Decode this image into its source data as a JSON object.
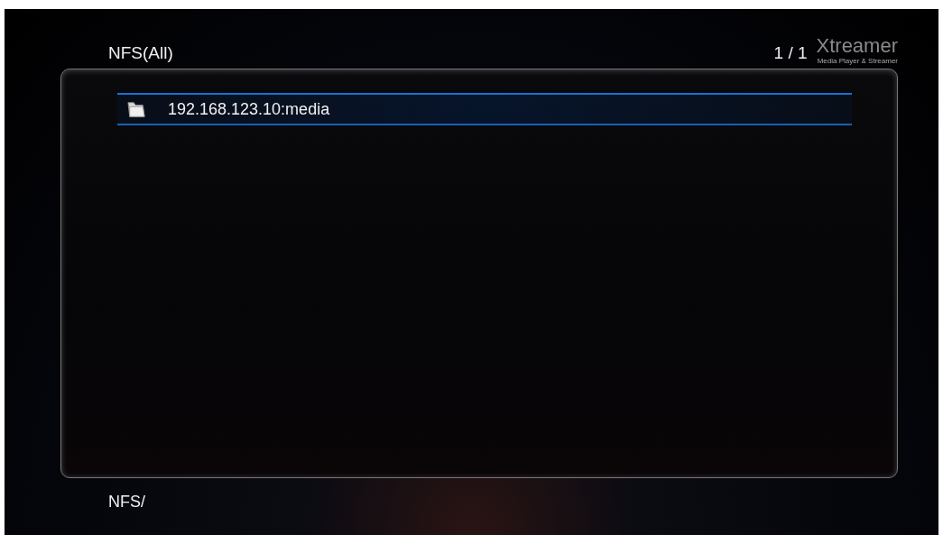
{
  "header": {
    "title": "NFS(All)",
    "page": "1 / 1",
    "logo": {
      "name": "Xtreamer",
      "tagline": "Media Player & Streamer"
    }
  },
  "items": [
    {
      "label": "192.168.123.10:media",
      "kind": "folder",
      "selected": true
    }
  ],
  "path": "NFS/"
}
